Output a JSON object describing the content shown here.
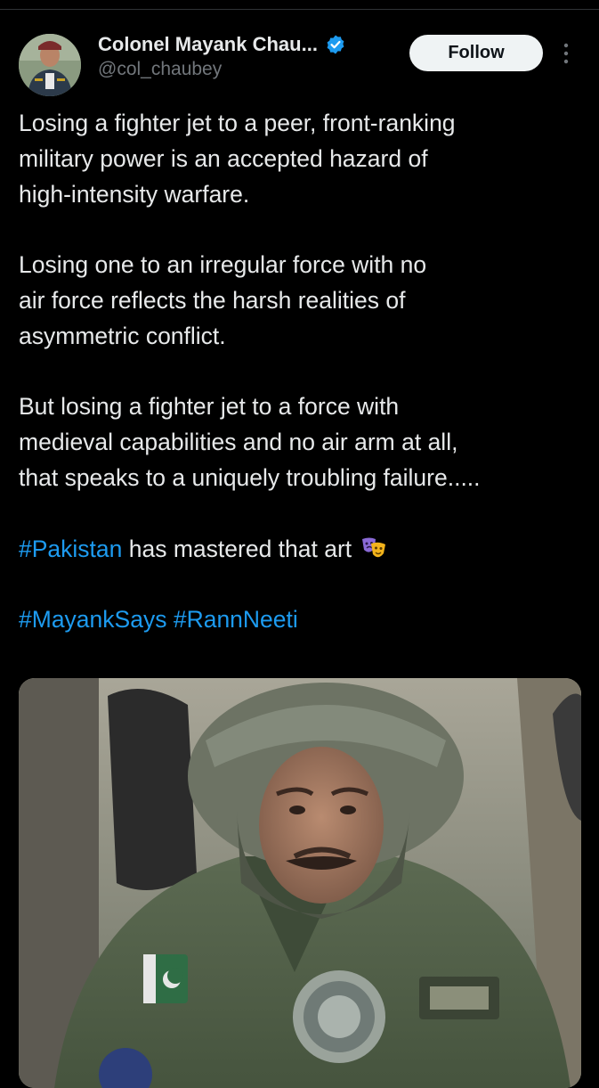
{
  "tweet": {
    "author": {
      "display_name": "Colonel Mayank Chau...",
      "handle": "@col_chaubey",
      "verified": true,
      "verified_icon": "verified-badge-icon"
    },
    "follow_label": "Follow",
    "more_icon": "more-vertical-icon",
    "paragraphs": [
      {
        "lines": [
          "Losing a fighter jet to a peer, front-ranking",
          "military power is an accepted hazard of",
          "high-intensity warfare."
        ]
      },
      {
        "lines": [
          "Losing one to an irregular force with no",
          "air force reflects the harsh realities of",
          "asymmetric conflict."
        ]
      },
      {
        "lines": [
          "But losing a fighter jet to a force with",
          "medieval capabilities and no air arm at all,",
          "that speaks to a uniquely troubling failure....."
        ]
      }
    ],
    "hashtag_line_1": {
      "hashtag": "#Pakistan",
      "text": " has mastered that art",
      "emoji": "performing-arts-masks-icon"
    },
    "hashtag_line_2": {
      "tag1": "#MayankSays",
      "tag2": "#RannNeeti"
    },
    "media": {
      "type": "photo",
      "subject": "pilot-photo"
    }
  },
  "colors": {
    "background": "#000000",
    "text": "#e7e9ea",
    "secondary_text": "#71767b",
    "link": "#1d9bf0",
    "follow_button_bg": "#eff3f4",
    "follow_button_text": "#0f1419"
  }
}
